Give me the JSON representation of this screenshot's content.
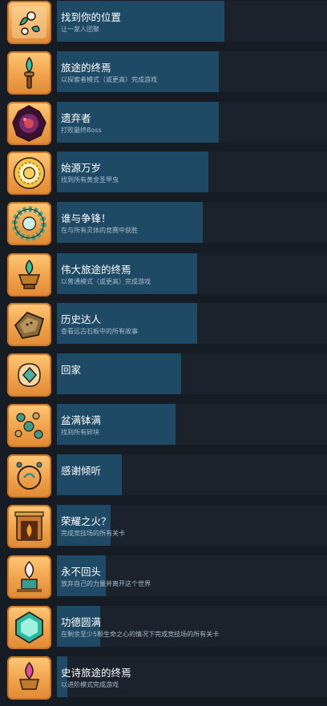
{
  "achievements": [
    {
      "title": "找到你的位置",
      "desc": "让一家人团聚",
      "progress": 0.62,
      "icon": "family-icon",
      "accent": "#3aa69a"
    },
    {
      "title": "旅途的终焉",
      "desc": "以探索者模式（或更高）完成游戏",
      "progress": 0.6,
      "icon": "torch-icon",
      "accent": "#2fc7b0"
    },
    {
      "title": "遗弃者",
      "desc": "打败最终Boss",
      "progress": 0.6,
      "icon": "dark-crystal-icon",
      "accent": "#7a2a6a"
    },
    {
      "title": "始源万岁",
      "desc": "找到所有黄金圣甲虫",
      "progress": 0.56,
      "icon": "golden-scarab-icon",
      "accent": "#e6b23a"
    },
    {
      "title": "谁与争锋！",
      "desc": "在与所有灵体的竞赛中获胜",
      "progress": 0.54,
      "icon": "wreath-icon",
      "accent": "#39a890"
    },
    {
      "title": "伟大旅途的终焉",
      "desc": "以普通模式（或更高）完成游戏",
      "progress": 0.52,
      "icon": "flame-brazier-icon",
      "accent": "#35c4a8"
    },
    {
      "title": "历史达人",
      "desc": "查看远古石板中的所有故事",
      "progress": 0.52,
      "icon": "stone-tablet-icon",
      "accent": "#8a6a3a"
    },
    {
      "title": "回家",
      "desc": "",
      "progress": 0.46,
      "icon": "home-gem-icon",
      "accent": "#4ab0a0"
    },
    {
      "title": "盆满钵满",
      "desc": "找到所有碎块",
      "progress": 0.44,
      "icon": "fragments-icon",
      "accent": "#3f9a8a"
    },
    {
      "title": "感谢倾听",
      "desc": "",
      "progress": 0.24,
      "icon": "music-notes-icon",
      "accent": "#3a8a90"
    },
    {
      "title": "荣耀之火？",
      "desc": "完成竞技场的所有关卡",
      "progress": 0.2,
      "icon": "temple-fire-icon",
      "accent": "#e07a2a"
    },
    {
      "title": "永不回头",
      "desc": "放弃自己的力量并离开这个世界",
      "progress": 0.18,
      "icon": "departure-icon",
      "accent": "#3a9a90"
    },
    {
      "title": "功德圆满",
      "desc": "在剩余至少5颗生命之心的情况下完成竞技场的所有关卡",
      "progress": 0.16,
      "icon": "heart-gem-icon",
      "accent": "#2ab8a0"
    },
    {
      "title": "史诗旅途的终焉",
      "desc": "以进阶模式完成游戏",
      "progress": 0.04,
      "icon": "pink-flame-icon",
      "accent": "#e04aa0"
    }
  ]
}
